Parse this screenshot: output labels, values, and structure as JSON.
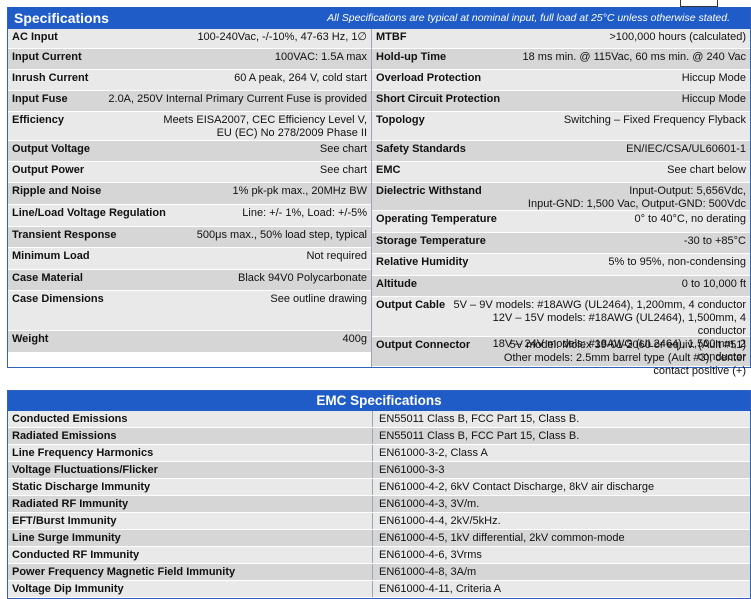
{
  "specifications": {
    "title": "Specifications",
    "note": "All Specifications are typical at nominal input, full load at 25°C unless otherwise stated.",
    "left": [
      {
        "label": "AC Input",
        "value": "100-240Vac, -/-10%,  47-63 Hz, 1∅"
      },
      {
        "label": "Input Current",
        "value": "100VAC:  1.5A max"
      },
      {
        "label": "Inrush Current",
        "value": "60 A peak, 264 V, cold start"
      },
      {
        "label": "Input Fuse",
        "value": "2.0A, 250V Internal Primary Current Fuse is provided"
      },
      {
        "label": "Efficiency",
        "value": "Meets EISA2007, CEC Efficiency Level V,\nEU (EC) No 278/2009 Phase II"
      },
      {
        "label": "Output Voltage",
        "value": "See chart"
      },
      {
        "label": "Output Power",
        "value": "See chart"
      },
      {
        "label": "Ripple and Noise",
        "value": "1% pk-pk max., 20MHz BW"
      },
      {
        "label": "Line/Load Voltage Regulation",
        "value": "Line: +/- 1%, Load: +/-5%"
      },
      {
        "label": "Transient Response",
        "value": "500μs max., 50% load step, typical"
      },
      {
        "label": "Minimum Load",
        "value": "Not required"
      },
      {
        "label": "Case Material",
        "value": "Black 94V0 Polycarbonate"
      },
      {
        "label": "Case Dimensions",
        "value": "See outline drawing"
      },
      {
        "label": "Weight",
        "value": "400g"
      }
    ],
    "right": [
      {
        "label": "MTBF",
        "value": ">100,000 hours (calculated)"
      },
      {
        "label": "Hold-up Time",
        "value": "18 ms min. @ 115Vac, 60 ms min. @ 240 Vac"
      },
      {
        "label": "Overload Protection",
        "value": "Hiccup Mode"
      },
      {
        "label": "Short Circuit Protection",
        "value": "Hiccup Mode"
      },
      {
        "label": "Topology",
        "value": "Switching – Fixed Frequency Flyback"
      },
      {
        "label": "Safety Standards",
        "value": "EN/IEC/CSA/UL60601-1"
      },
      {
        "label": "EMC",
        "value": "See chart below"
      },
      {
        "label": "Dielectric Withstand",
        "value": "Input-Output: 5,656Vdc,\nInput-GND: 1,500 Vac, Output-GND: 500Vdc"
      },
      {
        "label": "Operating Temperature",
        "value": "0° to 40°C, no derating"
      },
      {
        "label": "Storage Temperature",
        "value": "-30 to +85°C"
      },
      {
        "label": "Relative Humidity",
        "value": "5% to 95%, non-condensing"
      },
      {
        "label": "Altitude",
        "value": "0 to 10,000 ft"
      },
      {
        "label": "Output Cable",
        "value": "5V – 9V models: #18AWG (UL2464), 1,200mm, 4 conductor\n12V – 15V models: #18AWG (UL2464), 1,500mm, 4 conductor\n18V – 24V models: #18AWG (UL2464), 1,500mm, 2 conductor"
      },
      {
        "label": "Output Connector",
        "value": "5V model:  Molex 39-01-2060 or equiv. (Ault #51)\nOther models: 2.5mm barrel type (Ault #3),  center contact positive (+)"
      }
    ]
  },
  "emc": {
    "title": "EMC Specifications",
    "rows": [
      {
        "label": "Conducted Emissions",
        "value": "EN55011 Class B, FCC Part 15, Class B."
      },
      {
        "label": "Radiated Emissions",
        "value": "EN55011 Class B, FCC Part 15, Class B."
      },
      {
        "label": "Line Frequency Harmonics",
        "value": "EN61000-3-2, Class A"
      },
      {
        "label": "Voltage Fluctuations/Flicker",
        "value": "EN61000-3-3"
      },
      {
        "label": "Static Discharge Immunity",
        "value": "EN61000-4-2, 6kV Contact Discharge, 8kV air discharge"
      },
      {
        "label": "Radiated RF Immunity",
        "value": "EN61000-4-3, 3V/m."
      },
      {
        "label": "EFT/Burst Immunity",
        "value": "EN61000-4-4, 2kV/5kHz."
      },
      {
        "label": "Line Surge Immunity",
        "value": "EN61000-4-5, 1kV differential, 2kV common-mode"
      },
      {
        "label": "Conducted RF Immunity",
        "value": "EN61000-4-6, 3Vrms"
      },
      {
        "label": "Power Frequency Magnetic Field Immunity",
        "value": "EN61000-4-8, 3A/m"
      },
      {
        "label": "Voltage Dip Immunity",
        "value": "EN61000-4-11, Criteria  A"
      }
    ]
  }
}
